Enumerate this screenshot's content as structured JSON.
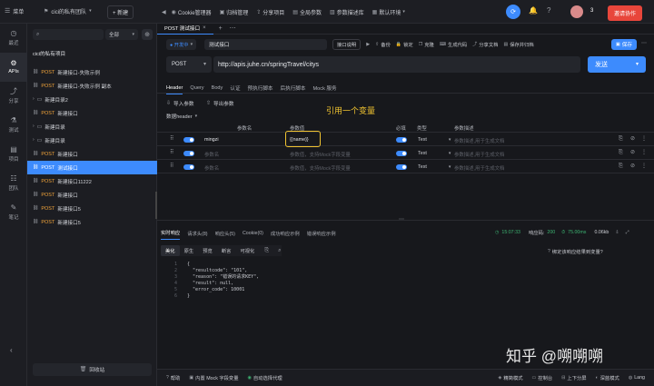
{
  "topbar": {
    "menu_label": "菜单",
    "team_label": "cici的私有团队",
    "new_label": "+ 新建",
    "items": [
      "Cookie管理器",
      "归档管理",
      "分享项目",
      "全局参数",
      "参数描述库",
      "默认环境"
    ],
    "badge": "3",
    "invite_label": "邀请协作"
  },
  "leftnav": {
    "items": [
      {
        "label": "最近",
        "icon": "clock-icon"
      },
      {
        "label": "APIs",
        "icon": "api-icon"
      },
      {
        "label": "分享",
        "icon": "share-icon"
      },
      {
        "label": "测试",
        "icon": "test-icon"
      },
      {
        "label": "项目",
        "icon": "project-icon"
      },
      {
        "label": "团队",
        "icon": "team-icon"
      },
      {
        "label": "笔记",
        "icon": "note-icon"
      }
    ]
  },
  "tree": {
    "filter_label": "全部",
    "project_title": "cici的私有项目",
    "items": [
      {
        "kind": "api",
        "method": "POST",
        "label": "新建接口-失败示例"
      },
      {
        "kind": "api",
        "method": "POST",
        "label": "新建接口-失败示例 副本"
      },
      {
        "kind": "folder",
        "label": "新建目录2"
      },
      {
        "kind": "api",
        "method": "POST",
        "label": "新建接口"
      },
      {
        "kind": "folder",
        "label": "新建目录"
      },
      {
        "kind": "folder",
        "label": "新建目录"
      },
      {
        "kind": "api",
        "method": "POST",
        "label": "新建接口"
      },
      {
        "kind": "api",
        "method": "POST",
        "label": "测试接口",
        "selected": true
      },
      {
        "kind": "api",
        "method": "POST",
        "label": "新建接口11222"
      },
      {
        "kind": "api",
        "method": "POST",
        "label": "新建接口"
      },
      {
        "kind": "api",
        "method": "POST",
        "label": "新建接口5"
      },
      {
        "kind": "api",
        "method": "POST",
        "label": "新建接口5"
      }
    ],
    "recycle_label": "回收站"
  },
  "main": {
    "tab_label": "POST 测试接口",
    "status_label": "● 开发中",
    "api_name": "测试接口",
    "actions": [
      "接口说明",
      "备份",
      "锁定",
      "克隆",
      "生成代码",
      "分享文档",
      "保存并归档"
    ],
    "save_label": "保存",
    "method": "POST",
    "url": "http://apis.juhe.cn/springTravel/citys",
    "send_label": "发送",
    "req_tabs": [
      "Header",
      "Query",
      "Body",
      "认证",
      "预执行脚本",
      "后执行脚本",
      "Mock 服务"
    ],
    "import_label": "导入参数",
    "export_label": "导出参数",
    "bulk_label": "数据header",
    "annotation": "引用一个变量",
    "table_headers": [
      "参数名",
      "参数值",
      "必填",
      "类型",
      "参数描述"
    ],
    "rows": [
      {
        "name": "mingzi",
        "value": "{{name}}",
        "type": "Text",
        "desc": "参数描述,用于生成文档"
      },
      {
        "name": "",
        "name_ph": "参数名",
        "value": "",
        "value_ph": "参数值，支持Mock字段变量",
        "type": "Text",
        "desc": "参数描述,用于生成文档"
      },
      {
        "name": "",
        "name_ph": "参数名",
        "value": "",
        "value_ph": "参数值，支持Mock字段变量",
        "type": "Text",
        "desc": "参数描述,用于生成文档"
      }
    ],
    "resp_tabs": [
      "实时响应",
      "请求头(8)",
      "响应头(5)",
      "Cookie(0)",
      "成功响应示例",
      "错误响应示例"
    ],
    "resp_time": "15:07:33",
    "resp_code_label": "响应码:",
    "resp_code": "200",
    "resp_ms": "75.00ms",
    "resp_size": "0.06kb",
    "view_tabs": [
      "美化",
      "原生",
      "预览",
      "断言",
      "可视化"
    ],
    "bind_label": "绑定该响应结果到变量?",
    "code_lines": [
      "{",
      "  \"resultcode\": \"101\",",
      "  \"reason\": \"错误的请求KEY\",",
      "  \"result\": null,",
      "  \"error_code\": 10001",
      "}"
    ],
    "bottom_left": [
      "帮助",
      "内置 Mock 字段变量",
      "自动选择代理"
    ],
    "bottom_right": [
      "精简模式",
      "控制台",
      "上下分屏",
      "深蓝模式",
      "Lang"
    ],
    "watermark": "知乎 @嗍嗍嗍"
  }
}
